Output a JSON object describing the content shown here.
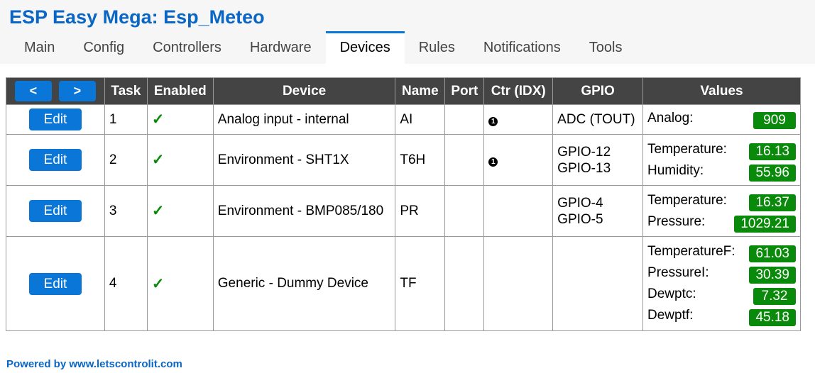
{
  "app": {
    "title": "ESP Easy Mega: Esp_Meteo"
  },
  "menu": {
    "tabs": [
      {
        "label": "Main"
      },
      {
        "label": "Config"
      },
      {
        "label": "Controllers"
      },
      {
        "label": "Hardware"
      },
      {
        "label": "Devices",
        "active": true
      },
      {
        "label": "Rules"
      },
      {
        "label": "Notifications"
      },
      {
        "label": "Tools"
      }
    ]
  },
  "table": {
    "prev_label": "<",
    "next_label": ">",
    "headers": {
      "task": "Task",
      "enabled": "Enabled",
      "device": "Device",
      "name": "Name",
      "port": "Port",
      "ctr": "Ctr (IDX)",
      "gpio": "GPIO",
      "values": "Values"
    },
    "edit_label": "Edit",
    "enabled_mark": "✓",
    "rows": [
      {
        "task": "1",
        "device": "Analog input - internal",
        "name": "AI",
        "port": "",
        "ctr": "❶",
        "gpio": [
          "ADC (TOUT)"
        ],
        "values": [
          {
            "label": "Analog:",
            "value": "909"
          }
        ]
      },
      {
        "task": "2",
        "device": "Environment - SHT1X",
        "name": "T6H",
        "port": "",
        "ctr": "❶",
        "gpio": [
          "GPIO-12",
          "GPIO-13"
        ],
        "values": [
          {
            "label": "Temperature:",
            "value": "16.13"
          },
          {
            "label": "Humidity:",
            "value": "55.96"
          }
        ]
      },
      {
        "task": "3",
        "device": "Environment - BMP085/180",
        "name": "PR",
        "port": "",
        "ctr": "",
        "gpio": [
          "GPIO-4",
          "GPIO-5"
        ],
        "values": [
          {
            "label": "Temperature:",
            "value": "16.37"
          },
          {
            "label": "Pressure:",
            "value": "1029.21"
          }
        ]
      },
      {
        "task": "4",
        "device": "Generic - Dummy Device",
        "name": "TF",
        "port": "",
        "ctr": "",
        "gpio": [],
        "values": [
          {
            "label": "TemperatureF:",
            "value": "61.03"
          },
          {
            "label": "PressureI:",
            "value": "30.39"
          },
          {
            "label": "Dewptc:",
            "value": "7.32"
          },
          {
            "label": "Dewptf:",
            "value": "45.18"
          }
        ]
      }
    ]
  },
  "footer": {
    "text": "Powered by www.letscontrolit.com"
  },
  "colors": {
    "accent": "#0a77d8",
    "title": "#0a66c4",
    "value_badge": "#0a8a0a",
    "header_bg": "#444444"
  }
}
